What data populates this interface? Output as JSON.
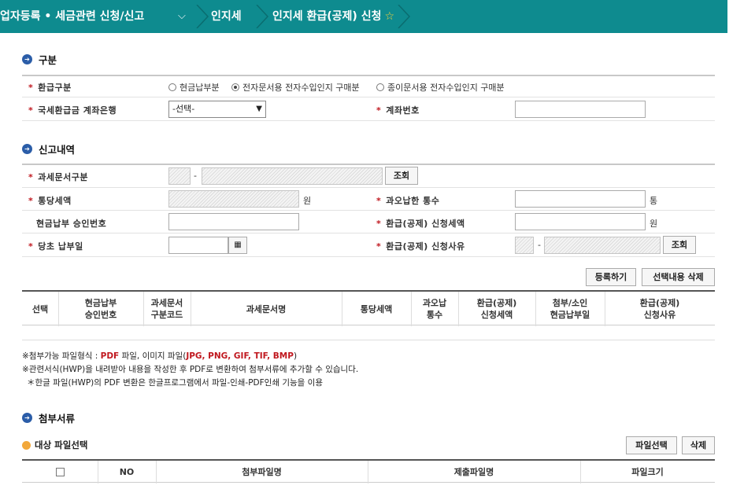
{
  "header": {
    "crumb1": "업자등록 • 세금관련 신청/신고",
    "crumb2": "인지세",
    "crumb3": "인지세 환급(공제) 신청",
    "dropdown_icon": "chevron-down-icon",
    "favorite_icon": "star-icon"
  },
  "colors": {
    "header_bg": "#0e8b8f",
    "required": "#c0171e",
    "section_icon": "#2b5da8",
    "subsection_dot": "#f2a83b"
  },
  "section1": {
    "title": "구분",
    "refund_type_label": "환급구분",
    "refund_options": [
      "현금납부분",
      "전자문서용 전자수입인지 구매분",
      "종이문서용 전자수입인지 구매분"
    ],
    "refund_selected_index": 1,
    "bank_label": "국세환급금 계좌은행",
    "bank_value": "-선택-",
    "account_label": "계좌번호",
    "account_value": ""
  },
  "section2": {
    "title": "신고내역",
    "doc_type_label": "과세문서구분",
    "dash": "-",
    "lookup_label": "조회",
    "tax_amount_label": "통당세액",
    "won": "원",
    "over_count_label": "과오납한 통수",
    "count_unit": "통",
    "cash_approval_label": "현금납부 승인번호",
    "refund_amount_label": "환급(공제) 신청세액",
    "initial_pay_date_label": "당초 납부일",
    "refund_reason_label": "환급(공제) 신청사유",
    "calendar_icon": "calendar-icon",
    "register_label": "등록하기",
    "delete_selected_label": "선택내용 삭제"
  },
  "report_table": {
    "headers": [
      "선택",
      "현금납부\n승인번호",
      "과세문서\n구분코드",
      "과세문서명",
      "통당세액",
      "과오납\n통수",
      "환급(공제)\n신청세액",
      "첨부/소인\n현금납부일",
      "환급(공제)\n신청사유"
    ]
  },
  "notes": {
    "line1_prefix": "※첨부가능 파일형식 : ",
    "line1_pdf": "PDF",
    "line1_mid": " 파일, 이미지 파일(",
    "line1_img": "JPG, PNG, GIF, TIF, BMP",
    "line1_suffix": ")",
    "line2": "※관련서식(HWP)을 내려받아 내용을 작성한 후 PDF로 변환하여 첨부서류에 추가할 수 있습니다.",
    "line3": "＊한글 파일(HWP)의 PDF 변환은 한글프로그램에서 파일-인쇄-PDF인쇄 기능을 이용"
  },
  "section3": {
    "title": "첨부서류",
    "subsection": "대상 파일선택",
    "file_select_label": "파일선택",
    "delete_label": "삭제",
    "headers": [
      "NO",
      "첨부파일명",
      "제출파일명",
      "파일크기"
    ]
  }
}
